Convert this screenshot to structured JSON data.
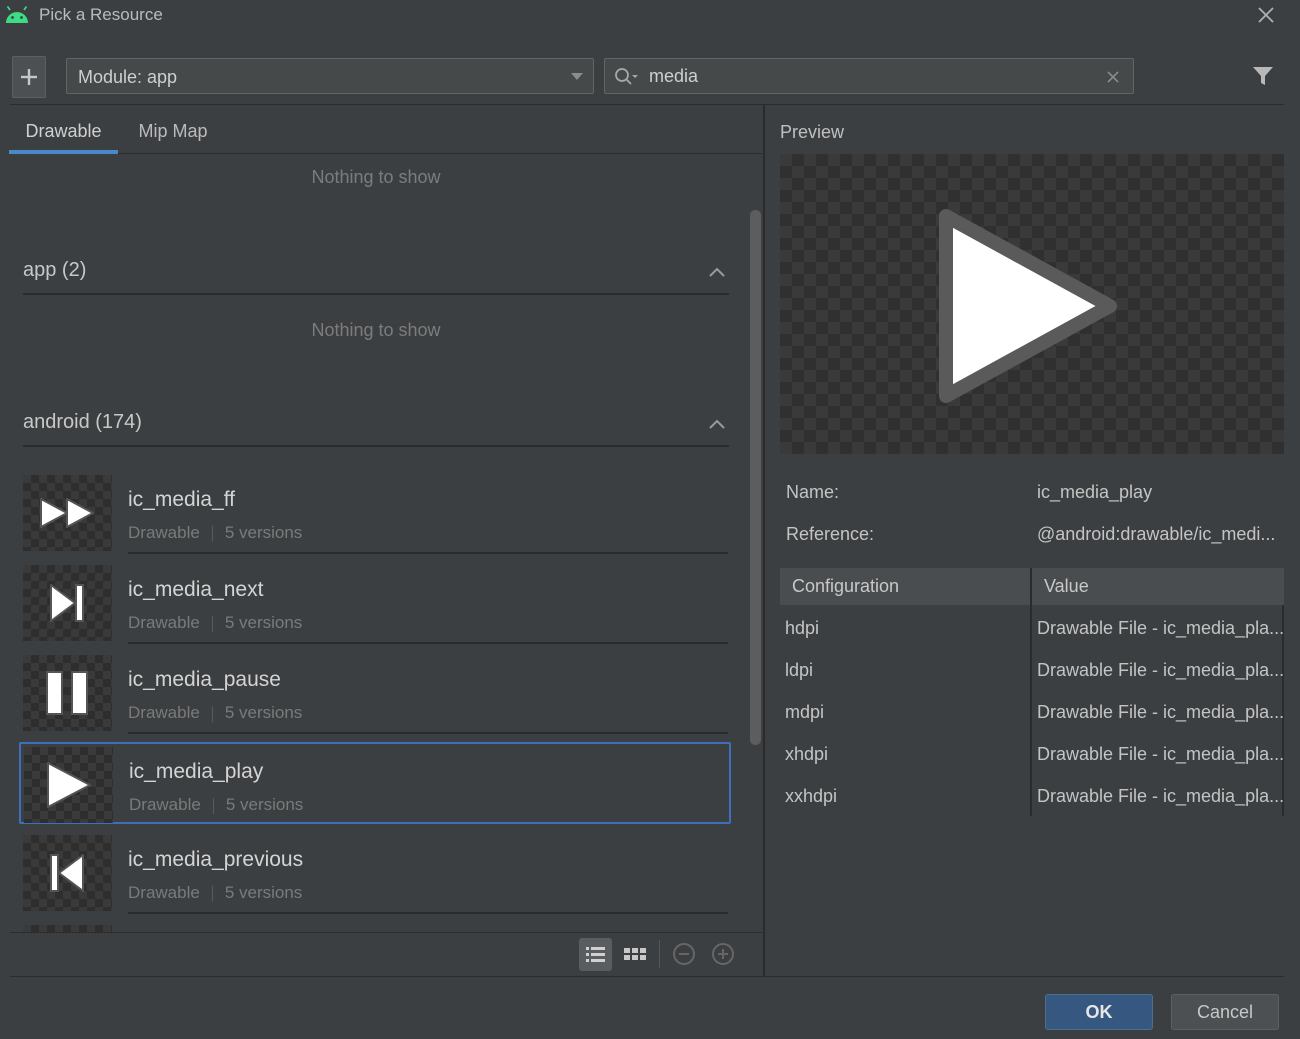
{
  "window": {
    "title": "Pick a Resource"
  },
  "toolbar": {
    "module_label": "Module: app",
    "search_value": "media"
  },
  "tabs": [
    {
      "label": "Drawable",
      "selected": true
    },
    {
      "label": "Mip Map",
      "selected": false
    }
  ],
  "list": {
    "nothing_to_show_1": "Nothing to show",
    "sections": [
      {
        "title": "app (2)",
        "empty_text": "Nothing to show"
      },
      {
        "title": "android (174)"
      }
    ],
    "items": [
      {
        "name": "ic_media_ff",
        "type": "Drawable",
        "versions": "5 versions",
        "icon": "fast-forward-icon",
        "selected": false
      },
      {
        "name": "ic_media_next",
        "type": "Drawable",
        "versions": "5 versions",
        "icon": "skip-next-icon",
        "selected": false
      },
      {
        "name": "ic_media_pause",
        "type": "Drawable",
        "versions": "5 versions",
        "icon": "pause-icon",
        "selected": false
      },
      {
        "name": "ic_media_play",
        "type": "Drawable",
        "versions": "5 versions",
        "icon": "play-icon",
        "selected": true
      },
      {
        "name": "ic_media_previous",
        "type": "Drawable",
        "versions": "5 versions",
        "icon": "skip-previous-icon",
        "selected": false
      }
    ]
  },
  "preview": {
    "label": "Preview",
    "name_label": "Name:",
    "name_value": "ic_media_play",
    "reference_label": "Reference:",
    "reference_value": "@android:drawable/ic_medi...",
    "table": {
      "headers": [
        "Configuration",
        "Value"
      ],
      "rows": [
        [
          "hdpi",
          "Drawable File - ic_media_pla..."
        ],
        [
          "ldpi",
          "Drawable File - ic_media_pla..."
        ],
        [
          "mdpi",
          "Drawable File - ic_media_pla..."
        ],
        [
          "xhdpi",
          "Drawable File - ic_media_pla..."
        ],
        [
          "xxhdpi",
          "Drawable File - ic_media_pla..."
        ]
      ]
    }
  },
  "buttons": {
    "ok": "OK",
    "cancel": "Cancel"
  },
  "colors": {
    "background": "#3c3f41",
    "accent": "#4a88c7",
    "selection_border": "#3d6fba",
    "ok_button": "#365880"
  }
}
